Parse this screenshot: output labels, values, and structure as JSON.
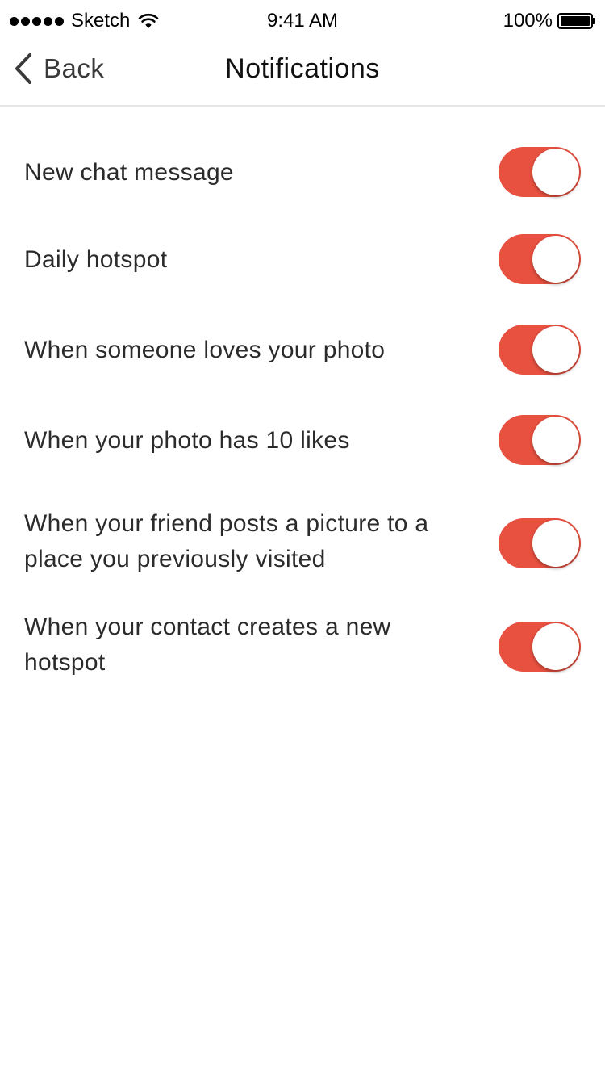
{
  "status_bar": {
    "carrier": "Sketch",
    "time": "9:41 AM",
    "battery": "100%",
    "signal_icon": "signal-dots-icon",
    "wifi_icon": "wifi-icon",
    "battery_icon": "battery-icon"
  },
  "nav": {
    "back_label": "Back",
    "back_icon": "chevron-left-icon",
    "title": "Notifications"
  },
  "colors": {
    "accent": "#e85040",
    "divider": "#e6e6e6"
  },
  "settings": [
    {
      "label": "New chat message",
      "enabled": true
    },
    {
      "label": "Daily hotspot",
      "enabled": true
    },
    {
      "label": "When someone loves your photo",
      "enabled": true
    },
    {
      "label": "When your photo has 10 likes",
      "enabled": true
    },
    {
      "label": "When your friend posts a picture to a place you previously visited",
      "enabled": true
    },
    {
      "label": "When your contact creates a new hotspot",
      "enabled": true
    }
  ]
}
